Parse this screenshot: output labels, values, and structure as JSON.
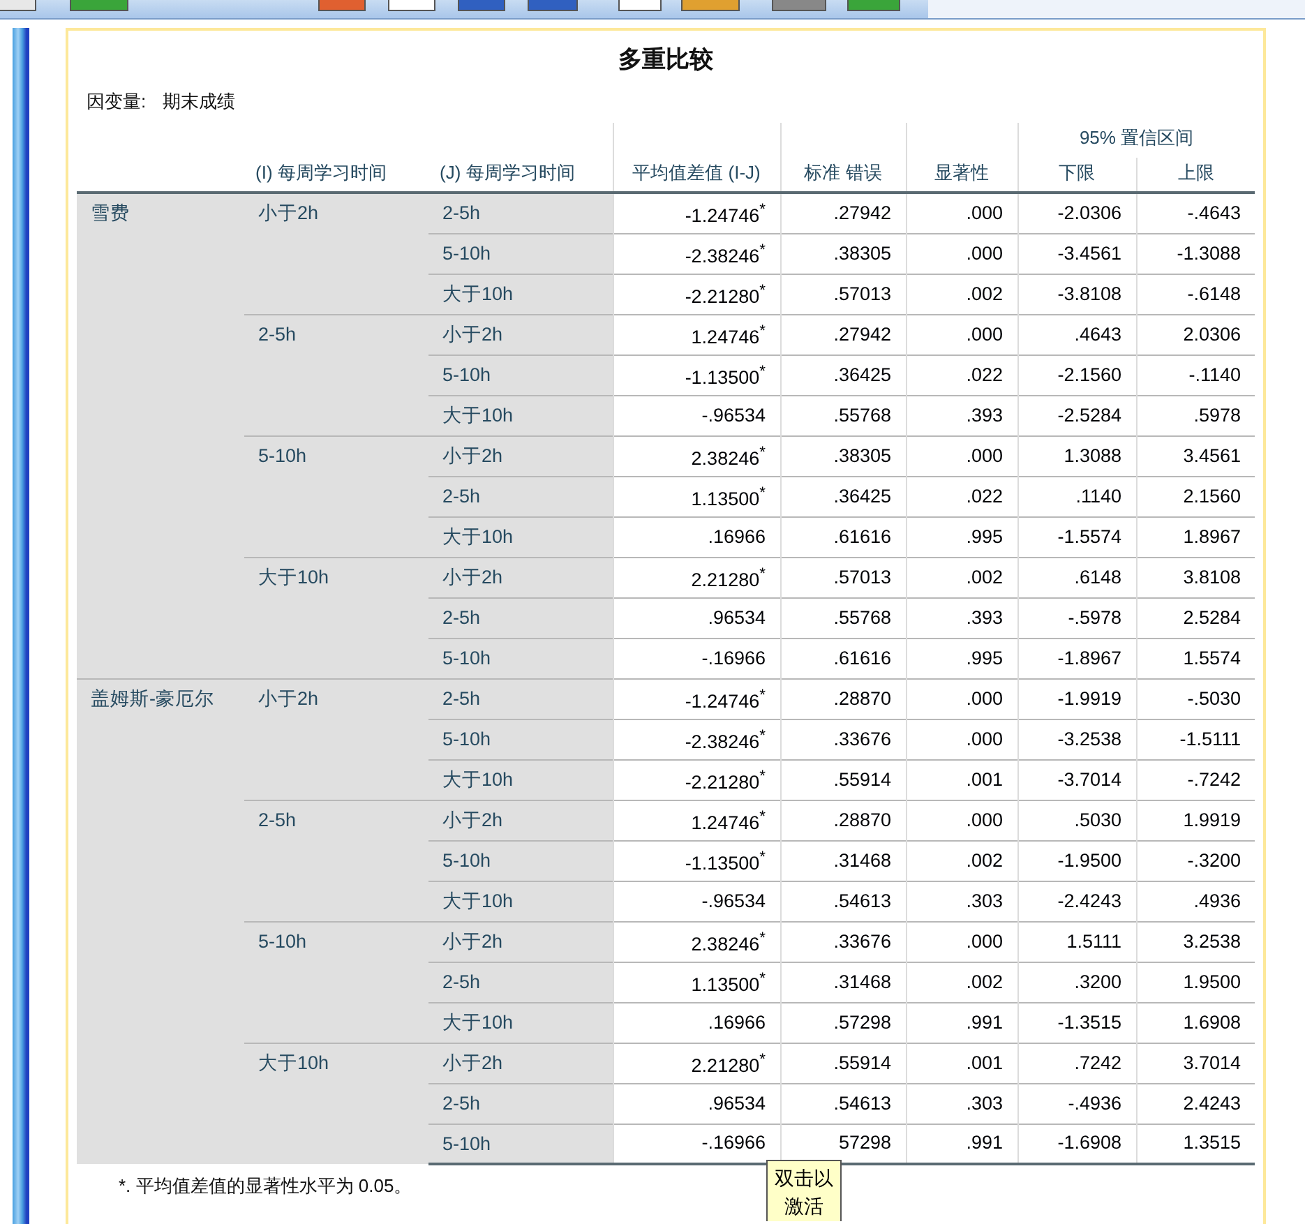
{
  "title": "多重比较",
  "dependent_variable": {
    "label": "因变量:",
    "value": "期末成绩"
  },
  "headers": {
    "i": "(I) 每周学习时间",
    "j": "(J) 每周学习时间",
    "mean_diff": "平均值差值 (I-J)",
    "std_error": "标准 错误",
    "sig": "显著性",
    "ci": "95% 置信区间",
    "lower": "下限",
    "upper": "上限"
  },
  "methods": [
    {
      "name": "雪费",
      "groups": [
        {
          "i": "小于2h",
          "rows": [
            {
              "j": "2-5h",
              "mean_diff": "-1.24746$^{*}$",
              "std_error": ".27942",
              "sig": ".000",
              "lower": "-2.0306",
              "upper": "-.4643"
            },
            {
              "j": "5-10h",
              "mean_diff": "-2.38246$^{*}$",
              "std_error": ".38305",
              "sig": ".000",
              "lower": "-3.4561",
              "upper": "-1.3088"
            },
            {
              "j": "大于10h",
              "mean_diff": "-2.21280$^{*}$",
              "std_error": ".57013",
              "sig": ".002",
              "lower": "-3.8108",
              "upper": "-.6148"
            }
          ]
        },
        {
          "i": "2-5h",
          "rows": [
            {
              "j": "小于2h",
              "mean_diff": "1.24746$^{*}$",
              "std_error": ".27942",
              "sig": ".000",
              "lower": ".4643",
              "upper": "2.0306"
            },
            {
              "j": "5-10h",
              "mean_diff": "-1.13500$^{*}$",
              "std_error": ".36425",
              "sig": ".022",
              "lower": "-2.1560",
              "upper": "-.1140"
            },
            {
              "j": "大于10h",
              "mean_diff": "-.96534",
              "std_error": ".55768",
              "sig": ".393",
              "lower": "-2.5284",
              "upper": ".5978"
            }
          ]
        },
        {
          "i": "5-10h",
          "rows": [
            {
              "j": "小于2h",
              "mean_diff": "2.38246$^{*}$",
              "std_error": ".38305",
              "sig": ".000",
              "lower": "1.3088",
              "upper": "3.4561"
            },
            {
              "j": "2-5h",
              "mean_diff": "1.13500$^{*}$",
              "std_error": ".36425",
              "sig": ".022",
              "lower": ".1140",
              "upper": "2.1560"
            },
            {
              "j": "大于10h",
              "mean_diff": ".16966",
              "std_error": ".61616",
              "sig": ".995",
              "lower": "-1.5574",
              "upper": "1.8967"
            }
          ]
        },
        {
          "i": "大于10h",
          "rows": [
            {
              "j": "小于2h",
              "mean_diff": "2.21280$^{*}$",
              "std_error": ".57013",
              "sig": ".002",
              "lower": ".6148",
              "upper": "3.8108"
            },
            {
              "j": "2-5h",
              "mean_diff": ".96534",
              "std_error": ".55768",
              "sig": ".393",
              "lower": "-.5978",
              "upper": "2.5284"
            },
            {
              "j": "5-10h",
              "mean_diff": "-.16966",
              "std_error": ".61616",
              "sig": ".995",
              "lower": "-1.8967",
              "upper": "1.5574"
            }
          ]
        }
      ]
    },
    {
      "name": "盖姆斯-豪厄尔",
      "groups": [
        {
          "i": "小于2h",
          "rows": [
            {
              "j": "2-5h",
              "mean_diff": "-1.24746$^{*}$",
              "std_error": ".28870",
              "sig": ".000",
              "lower": "-1.9919",
              "upper": "-.5030"
            },
            {
              "j": "5-10h",
              "mean_diff": "-2.38246$^{*}$",
              "std_error": ".33676",
              "sig": ".000",
              "lower": "-3.2538",
              "upper": "-1.5111"
            },
            {
              "j": "大于10h",
              "mean_diff": "-2.21280$^{*}$",
              "std_error": ".55914",
              "sig": ".001",
              "lower": "-3.7014",
              "upper": "-.7242"
            }
          ]
        },
        {
          "i": "2-5h",
          "rows": [
            {
              "j": "小于2h",
              "mean_diff": "1.24746$^{*}$",
              "std_error": ".28870",
              "sig": ".000",
              "lower": ".5030",
              "upper": "1.9919"
            },
            {
              "j": "5-10h",
              "mean_diff": "-1.13500$^{*}$",
              "std_error": ".31468",
              "sig": ".002",
              "lower": "-1.9500",
              "upper": "-.3200"
            },
            {
              "j": "大于10h",
              "mean_diff": "-.96534",
              "std_error": ".54613",
              "sig": ".303",
              "lower": "-2.4243",
              "upper": ".4936"
            }
          ]
        },
        {
          "i": "5-10h",
          "rows": [
            {
              "j": "小于2h",
              "mean_diff": "2.38246$^{*}$",
              "std_error": ".33676",
              "sig": ".000",
              "lower": "1.5111",
              "upper": "3.2538"
            },
            {
              "j": "2-5h",
              "mean_diff": "1.13500$^{*}$",
              "std_error": ".31468",
              "sig": ".002",
              "lower": ".3200",
              "upper": "1.9500"
            },
            {
              "j": "大于10h",
              "mean_diff": ".16966",
              "std_error": ".57298",
              "sig": ".991",
              "lower": "-1.3515",
              "upper": "1.6908"
            }
          ]
        },
        {
          "i": "大于10h",
          "rows": [
            {
              "j": "小于2h",
              "mean_diff": "2.21280$^{*}$",
              "std_error": ".55914",
              "sig": ".001",
              "lower": ".7242",
              "upper": "3.7014"
            },
            {
              "j": "2-5h",
              "mean_diff": ".96534",
              "std_error": ".54613",
              "sig": ".303",
              "lower": "-.4936",
              "upper": "2.4243"
            },
            {
              "j": "5-10h",
              "mean_diff": "-.16966",
              "std_error": "57298",
              "sig": ".991",
              "lower": "-1.6908",
              "upper": "1.3515"
            }
          ]
        }
      ]
    }
  ],
  "footnote": "*. 平均值差值的显著性水平为 0.05。",
  "tooltip": "双击以激活"
}
